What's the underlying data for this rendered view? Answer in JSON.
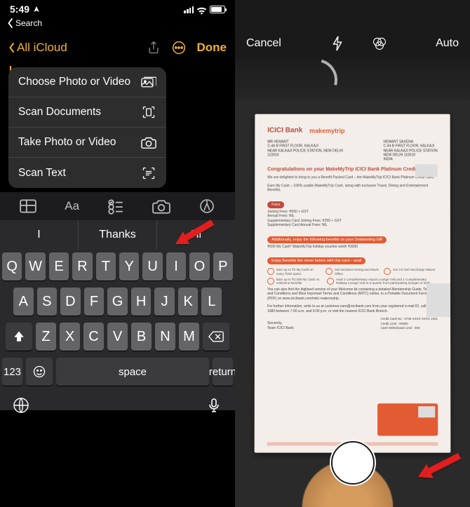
{
  "left": {
    "status": {
      "time": "5:49"
    },
    "back_search": "Search",
    "nav": {
      "back_label": "All iCloud",
      "done_label": "Done"
    },
    "menu": {
      "choose": "Choose Photo or Video",
      "scan": "Scan Documents",
      "take": "Take Photo or Video",
      "scantext": "Scan Text"
    },
    "toolbar_aa": "Aa",
    "predictions": {
      "p1": "I",
      "p2": "Thanks",
      "p3": "Hi"
    },
    "keys": {
      "row1": [
        "Q",
        "W",
        "E",
        "R",
        "T",
        "Y",
        "U",
        "I",
        "O",
        "P"
      ],
      "row2": [
        "A",
        "S",
        "D",
        "F",
        "G",
        "H",
        "J",
        "K",
        "L"
      ],
      "row3": [
        "Z",
        "X",
        "C",
        "V",
        "B",
        "N",
        "M"
      ],
      "num_label": "123",
      "space_label": "space",
      "return_label": "return"
    }
  },
  "right": {
    "cancel_label": "Cancel",
    "auto_label": "Auto",
    "doc": {
      "logo1": "ICICI Bank",
      "logo2": "makemytrip",
      "addr_left": "MR HEMANT\\nC-44 B FIRST FLOOR, KALKAJI\\nNEAR KALKAJI POLICE STATION, NEW DELHI\\n110019",
      "addr_right": "HEMANT SAXENA\\nC-44 B FIRST FLOOR, KALKAJI\\nNEAR KALKAJI POLICE STATION\\nNEW DELHI 110019\\nINDIA",
      "title": "Congratulations on your MakeMyTrip ICICI Bank Platinum Credit Card",
      "line1": "We are delighted to bring to you a Benefit Packed Card – the MakeMyTrip ICICI Bank Platinum Credit Card.",
      "line2": "Earn My Cash – 100% usable MakeMyTrip Cash, along with exclusive Travel, Dining and Entertainment Benefits.",
      "fees_head": "Fees",
      "fees_body": "Joining Fees: ₹500 + GST\\nAnnual Fees: NIL\\nSupplementary Card Joining Fees: ₹250 + GST\\nSupplementary Card Annual Fees: NIL",
      "pill_add": "Additionally, enjoy the following benefits on your Outstanding Gift",
      "add_body": "₹500 My Cash*     MakeMyTrip holiday voucher worth ₹3000",
      "pill_ben": "Enjoy Benefits like never before with this card – avail",
      "ben1": "Earn up to ₹2 My Cash on every ₹200 spent",
      "ben2": "Get exclusive Dining and Movie Offers",
      "ben3": "Get 1% fuel Surcharge Waiver",
      "ben4": "Earn up to ₹2,000 My Cash on milestone benefits",
      "ben5": "Avail 1 Complimentary Airport Lounge Visit and 1 Complimentary Railway Lounge Visit in a quarter from participating lounges in India",
      "foot1": "You can also find the digitised version of your Welcome kit containing a detailed Membership Guide, Terms and Conditions and Most Important Terms and Conditions (MITC) online, in a Portable Document Format (PDF) on www.icicibank.com/mitc-makemytrip.",
      "foot2": "For further information, write to us at customer.care@icicibank.com from your registered e-mail ID, call 1800 1080 between 7:00 a.m. and 9:00 p.m. or visit the nearest ICICI Bank Branch.",
      "sign": "Sincerely,\\nTeam ICICI Bank",
      "card_no_label": "Credit Card No : ",
      "card_no": "4746 XXXX XXXX 1001",
      "credit_limit_label": "Credit Limit : ",
      "credit_limit": "50000",
      "cash_limit_label": "Cash Withdrawal Limit : ",
      "cash_limit": "500"
    }
  }
}
